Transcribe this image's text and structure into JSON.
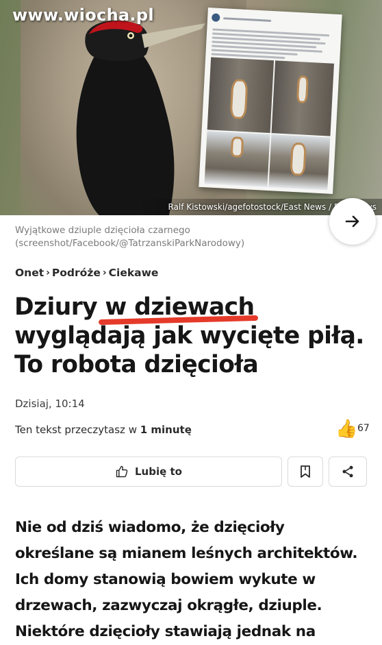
{
  "hero": {
    "watermark": "www.wiocha.pl",
    "photo_credit": "Ralf Kistowski/agefotostock/East News / East News",
    "embedded_post_alt": "Tatrzański Park Narodowy Facebook post with photos of tree hollows"
  },
  "photo_caption": "Wyjątkowe dziuple dzięcioła czarnego (screenshot/Facebook/@TatrzanskiParkNarodowy)",
  "breadcrumb": {
    "items": [
      "Onet",
      "Podróże",
      "Ciekawe"
    ],
    "separator": "›"
  },
  "article": {
    "title": "Dziury w dziewach wyglądają jak wycięte piłą. To robota dzięcioła",
    "date": "Dzisiaj, 10:14",
    "read_time_prefix": "Ten tekst przeczytasz w ",
    "read_time_value": "1 minutę",
    "reaction_emoji": "👍",
    "reaction_count": "67",
    "lead": "Nie od dziś wiadomo, że dzięcioły określane są mianem leśnych architektów. Ich domy stanowią bowiem wykute w drzewach, zazwyczaj okrągłe, dziuple. Niektóre dzięcioły stawiają jednak na"
  },
  "actions": {
    "like_label": "Lubię to"
  },
  "icons": {
    "next": "arrow-right-icon",
    "like": "thumbs-up-icon",
    "bookmark": "bookmark-icon",
    "share": "share-icon"
  },
  "colors": {
    "underline_accent": "#e53a2a",
    "text": "#161616",
    "caption": "#7a7a7a"
  }
}
